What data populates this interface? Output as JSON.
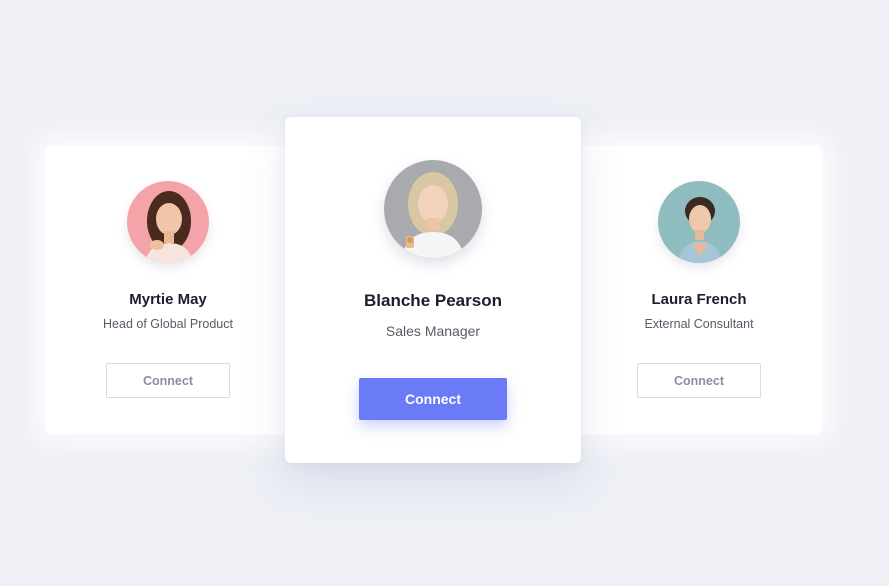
{
  "cards": [
    {
      "name": "Myrtie May",
      "role": "Head of Global Product",
      "button_label": "Connect",
      "avatar_bg": "#f4a3a8"
    },
    {
      "name": "Blanche Pearson",
      "role": "Sales Manager",
      "button_label": "Connect",
      "avatar_bg": "#a9aaad"
    },
    {
      "name": "Laura French",
      "role": "External Consultant",
      "button_label": "Connect",
      "avatar_bg": "#8fbcbf"
    }
  ],
  "colors": {
    "page_background": "#eef0f6",
    "card_background": "#ffffff",
    "primary_button": "#6b7bf7",
    "name_text": "#1c1f2e",
    "role_text": "#555a66"
  }
}
